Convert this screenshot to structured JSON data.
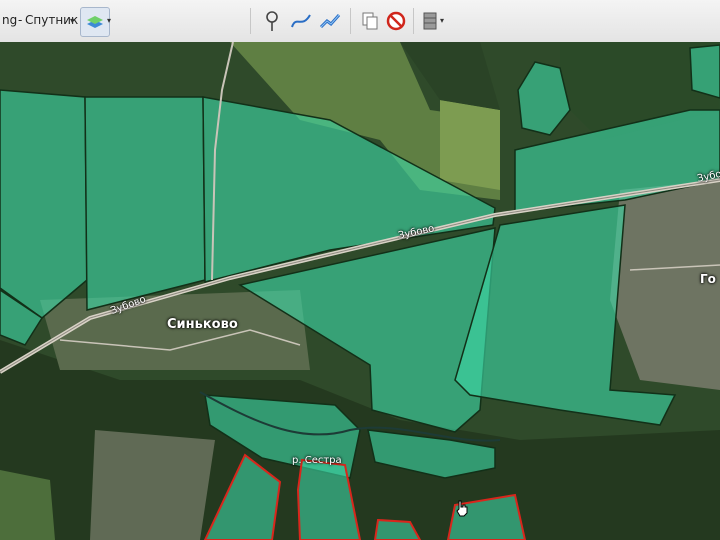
{
  "toolbar": {
    "provider_label": "ng",
    "map_type_label": "Спутник",
    "tools": [
      {
        "name": "layers-icon"
      },
      {
        "name": "placemark-pin-icon"
      },
      {
        "name": "draw-line-icon"
      },
      {
        "name": "route-icon"
      },
      {
        "name": "copy-objects-icon"
      },
      {
        "name": "cancel-icon"
      },
      {
        "name": "panel-view-icon"
      }
    ]
  },
  "map": {
    "labels": {
      "village": "Синьково",
      "road_1": "Зубово",
      "road_2": "Зубово",
      "road_3": "Зубово",
      "river": "р. Сестра",
      "edge_fragment": "Го"
    },
    "colors": {
      "parcel_fill": "#3dd6a5",
      "parcel_border": "#123018",
      "parcel_red_border": "#d9261c",
      "satellite_base": "#2f4a2a"
    }
  }
}
